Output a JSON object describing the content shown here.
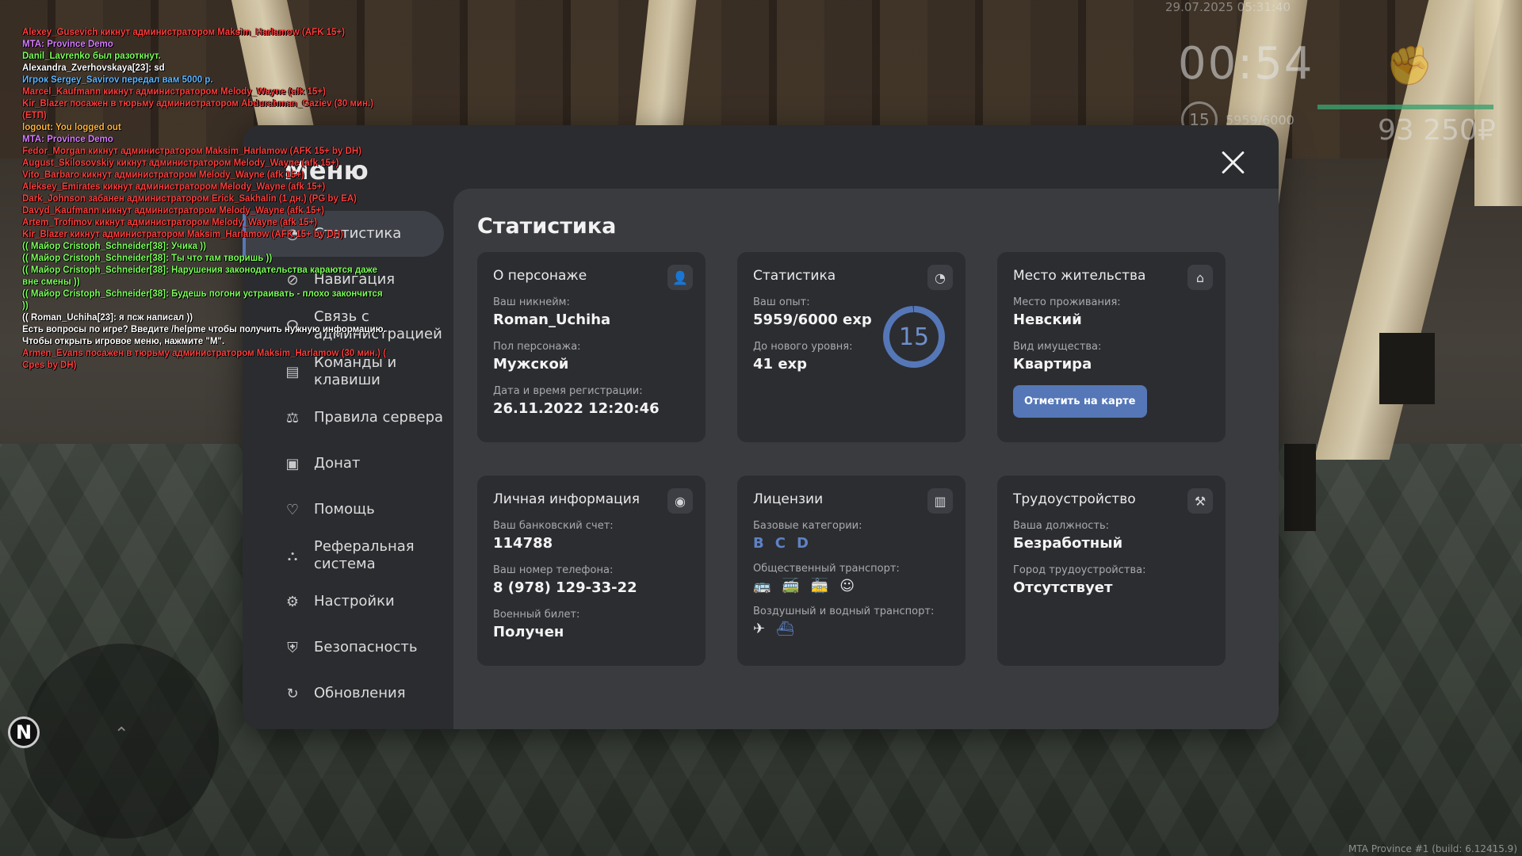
{
  "hud": {
    "date": "29.07.2025 05:31:40",
    "time": "00:54",
    "level": "15",
    "exp": "5959/6000",
    "money": "93 250₽",
    "build": "MTA Province #1 (build: 6.12415.9)",
    "compass": "N"
  },
  "chat": [
    {
      "text": "Alexey_Gusevich кикнут администратором Maksim_Harlamow (AFK 15+)",
      "color": "#ff3c3c"
    },
    {
      "text": "MTA: Province Demo",
      "color": "#d77cff"
    },
    {
      "text": "Danil_Lavrenko был разоткнут.",
      "color": "#7cff5a"
    },
    {
      "text": "Alexandra_Zverhovskaya[23]: sd",
      "color": "#ffffff"
    },
    {
      "text": "Игрок Sergey_Savirov передал вам 5000 р.",
      "color": "#5fb6ff"
    },
    {
      "text": "Marcel_Kaufmann кикнут администратором Melody_Wayne (afk 15+)",
      "color": "#ff3c3c"
    },
    {
      "text": "Kir_Blazer посажен в тюрьму администратором Abdurahman_Gaziev (30 мин.)",
      "color": "#ff3c3c"
    },
    {
      "text": "(ЕТП)",
      "color": "#ff3c3c"
    },
    {
      "text": "logout: You logged out",
      "color": "#ffb43c"
    },
    {
      "text": "MTA: Province Demo",
      "color": "#d77cff"
    },
    {
      "text": "Fedor_Morgan кикнут администратором Maksim_Harlamow (AFK 15+ by DH)",
      "color": "#ff3c3c"
    },
    {
      "text": "August_Skilosovskiy кикнут администратором Melody_Wayne (afk 15+)",
      "color": "#ff3c3c"
    },
    {
      "text": "Vito_Barbaro кикнут администратором Melody_Wayne (afk 15+)",
      "color": "#ff3c3c"
    },
    {
      "text": "Aleksey_Emirates кикнут администратором Melody_Wayne (afk 15+)",
      "color": "#ff3c3c"
    },
    {
      "text": "Dark_Johnson забанен администратором Erick_Sakhalin (1 дн.) (PG by EA)",
      "color": "#ff3c3c"
    },
    {
      "text": "Davyd_Kaufmann кикнут администратором Melody_Wayne (afk 15+)",
      "color": "#ff3c3c"
    },
    {
      "text": "Artem_Trofimov кикнут администратором Melody_Wayne (afk 15+)",
      "color": "#ff3c3c"
    },
    {
      "text": "Kir_Blazer кикнут администратором Maksim_Harlamow (AFK 15+ by DH)",
      "color": "#ff3c3c"
    },
    {
      "text": "(( Майор Cristoph_Schneider[38]: Учика ))",
      "color": "#7cff5a"
    },
    {
      "text": "(( Майор Cristoph_Schneider[38]: Ты что там творишь ))",
      "color": "#7cff5a"
    },
    {
      "text": "(( Майор Cristoph_Schneider[38]: Нарушения законодательства караются даже",
      "color": "#7cff5a"
    },
    {
      "text": "вне смены ))",
      "color": "#7cff5a"
    },
    {
      "text": "(( Майор Cristoph_Schneider[38]: Будешь погони устраивать - плохо закончится",
      "color": "#7cff5a"
    },
    {
      "text": "))",
      "color": "#7cff5a"
    },
    {
      "text": "(( Roman_Uchiha[23]: я псж написал ))",
      "color": "#ffffff"
    },
    {
      "text": "Есть вопросы по игре? Введите /helpme чтобы получить нужную информацию.",
      "color": "#ffffff"
    },
    {
      "text": "Чтобы открыть игровое меню, нажмите \"M\".",
      "color": "#ffffff"
    },
    {
      "text": "Armen_Evans посажен в тюрьму администратором Maksim_Harlamow (30 мин.) (",
      "color": "#ff3c3c"
    },
    {
      "text": "Cpes by DH)",
      "color": "#ff3c3c"
    }
  ],
  "menu": {
    "title": "Меню",
    "nav": [
      {
        "label": "Статистика",
        "icon": "stats-icon",
        "glyph": "◔",
        "active": true
      },
      {
        "label": "Навигация",
        "icon": "compass-icon",
        "glyph": "⊘",
        "active": false
      },
      {
        "label": "Связь с администрацией",
        "icon": "headset-icon",
        "glyph": "☊",
        "active": false
      },
      {
        "label": "Команды и клавиши",
        "icon": "document-icon",
        "glyph": "▤",
        "active": false
      },
      {
        "label": "Правила сервера",
        "icon": "scales-icon",
        "glyph": "⚖",
        "active": false
      },
      {
        "label": "Донат",
        "icon": "wallet-icon",
        "glyph": "▣",
        "active": false
      },
      {
        "label": "Помощь",
        "icon": "heart-hand-icon",
        "glyph": "♡",
        "active": false
      },
      {
        "label": "Реферальная система",
        "icon": "referral-icon",
        "glyph": "⛬",
        "active": false
      },
      {
        "label": "Настройки",
        "icon": "gear-icon",
        "glyph": "⚙",
        "active": false
      },
      {
        "label": "Безопасность",
        "icon": "shield-icon",
        "glyph": "⛨",
        "active": false
      },
      {
        "label": "Обновления",
        "icon": "update-icon",
        "glyph": "↻",
        "active": false
      }
    ]
  },
  "content": {
    "title": "Статистика",
    "character": {
      "title": "О персонаже",
      "nickname_label": "Ваш никнейм:",
      "nickname": "Roman_Uchiha",
      "gender_label": "Пол персонажа:",
      "gender": "Мужской",
      "reg_label": "Дата и время регистрации:",
      "reg": "26.11.2022 12:20:46"
    },
    "stats": {
      "title": "Статистика",
      "exp_label": "Ваш опыт:",
      "exp": "5959/6000 exp",
      "next_label": "До нового уровня:",
      "next": "41 exp",
      "level": "15",
      "progress": 0.9932
    },
    "residence": {
      "title": "Место жительства",
      "place_label": "Место проживания:",
      "place": "Невский",
      "property_label": "Вид имущества:",
      "property": "Квартира",
      "button": "Отметить на карте"
    },
    "personal": {
      "title": "Личная информация",
      "bank_label": "Ваш банковский счет:",
      "bank": "114788",
      "phone_label": "Ваш номер телефона:",
      "phone": "8 (978) 129-33-22",
      "military_label": "Военный билет:",
      "military": "Получен"
    },
    "licenses": {
      "title": "Лицензии",
      "base_label": "Базовые категории:",
      "categories": [
        "B",
        "C",
        "D"
      ],
      "public_label": "Общественный транспорт:",
      "air_label": "Воздушный и водный транспорт:"
    },
    "employment": {
      "title": "Трудоустройство",
      "position_label": "Ваша должность:",
      "position": "Безработный",
      "city_label": "Город трудоустройства:",
      "city": "Отсутствует"
    }
  },
  "colors": {
    "accent": "#5577b7",
    "card": "#2c2d31",
    "panel": "#3a3b3f"
  }
}
